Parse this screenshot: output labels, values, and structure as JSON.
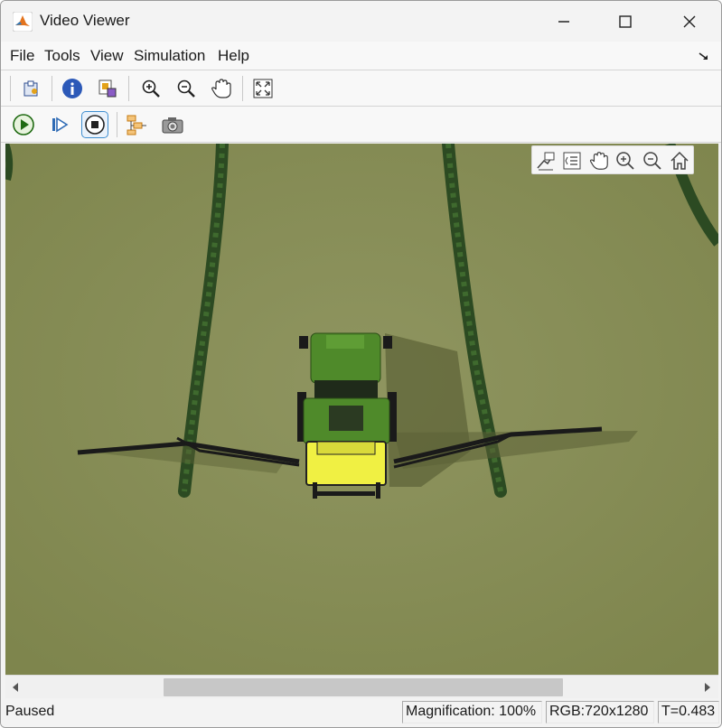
{
  "window": {
    "title": "Video Viewer",
    "icon": "matlab-icon",
    "controls": [
      "minimize-icon",
      "maximize-icon",
      "close-icon"
    ]
  },
  "menu": {
    "items": [
      "File",
      "Tools",
      "View",
      "Simulation",
      "Help"
    ],
    "undock_icon": "undock-arrow-icon"
  },
  "toolbar1": {
    "buttons": [
      "print-icon",
      "info-icon",
      "image-export-icon",
      "zoom-in-icon",
      "zoom-out-icon",
      "pan-hand-icon",
      "fit-to-window-icon"
    ]
  },
  "toolbar2": {
    "buttons": [
      "play-icon",
      "step-forward-icon",
      "stop-icon",
      "highlight-block-icon",
      "snapshot-camera-icon"
    ],
    "active": "stop-icon"
  },
  "axes_toolbar": {
    "buttons": [
      "data-tips-icon",
      "legend-icon",
      "pan-hand-icon",
      "zoom-in-icon",
      "zoom-out-icon",
      "home-icon"
    ]
  },
  "scene": {
    "description_colors": {
      "ground": "#8a8f58",
      "tractor_body": "#4f8a2a",
      "tank": "#f0f043",
      "boom": "#1d1d1d",
      "vine": "#2f4f22"
    }
  },
  "status": {
    "state": "Paused",
    "magnification": "Magnification: 100%",
    "format": "RGB:720x1280",
    "time": "T=0.483"
  }
}
